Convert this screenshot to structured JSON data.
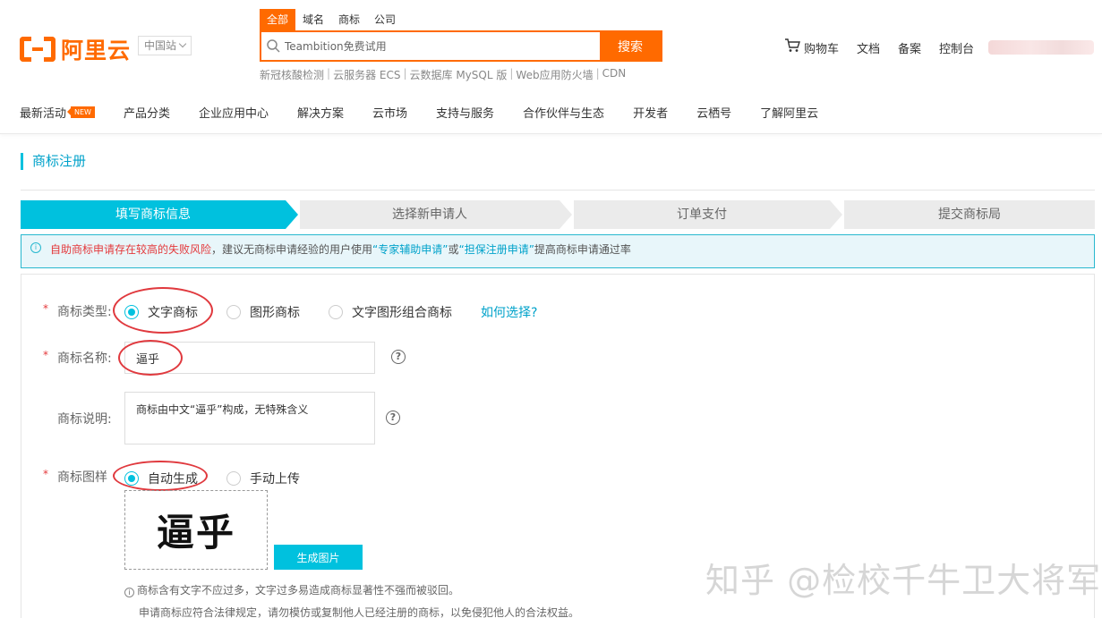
{
  "header": {
    "logo_text": "阿里云",
    "region": "中国站",
    "search_tabs": [
      "全部",
      "域名",
      "商标",
      "公司"
    ],
    "search_placeholder": "Teambition免费试用",
    "search_button": "搜索",
    "hot_links": [
      "新冠核酸检测",
      "云服务器 ECS",
      "云数据库 MySQL 版",
      "Web应用防火墙",
      "CDN"
    ],
    "right_items": [
      "购物车",
      "文档",
      "备案",
      "控制台"
    ]
  },
  "nav": {
    "items": [
      "最新活动",
      "产品分类",
      "企业应用中心",
      "解决方案",
      "云市场",
      "支持与服务",
      "合作伙伴与生态",
      "开发者",
      "云栖号",
      "了解阿里云"
    ],
    "new_badge": "NEW"
  },
  "page": {
    "title": "商标注册",
    "steps": [
      "填写商标信息",
      "选择新申请人",
      "订单支付",
      "提交商标局"
    ],
    "alert": {
      "red_text": "自助商标申请存在较高的失败风险",
      "text1": "，建议无商标申请经验的用户使用",
      "link1": "“专家辅助申请”",
      "text2": "或",
      "link2": "“担保注册申请”",
      "text3": "提高商标申请通过率"
    }
  },
  "form": {
    "type_label": "商标类型:",
    "type_options": [
      "文字商标",
      "图形商标",
      "文字图形组合商标"
    ],
    "how_to_choose": "如何选择?",
    "name_label": "商标名称:",
    "name_value": "逼乎",
    "desc_label": "商标说明:",
    "desc_value": "商标由中文“逼乎”构成，无特殊含义",
    "sample_label": "商标图样",
    "sample_options": [
      "自动生成",
      "手动上传"
    ],
    "preview_text": "逼乎",
    "generate_button": "生成图片",
    "note1": "商标含有文字不应过多，文字过多易造成商标显著性不强而被驳回。",
    "note2": "申请商标应符合法律规定，请勿模仿或复制他人已经注册的商标，以免侵犯他人的合法权益。"
  },
  "watermark": "知乎 @检校千牛卫大将军",
  "colors": {
    "brand": "#ff6a00",
    "accent": "#00c1de",
    "highlight_circle": "#e0393e"
  }
}
